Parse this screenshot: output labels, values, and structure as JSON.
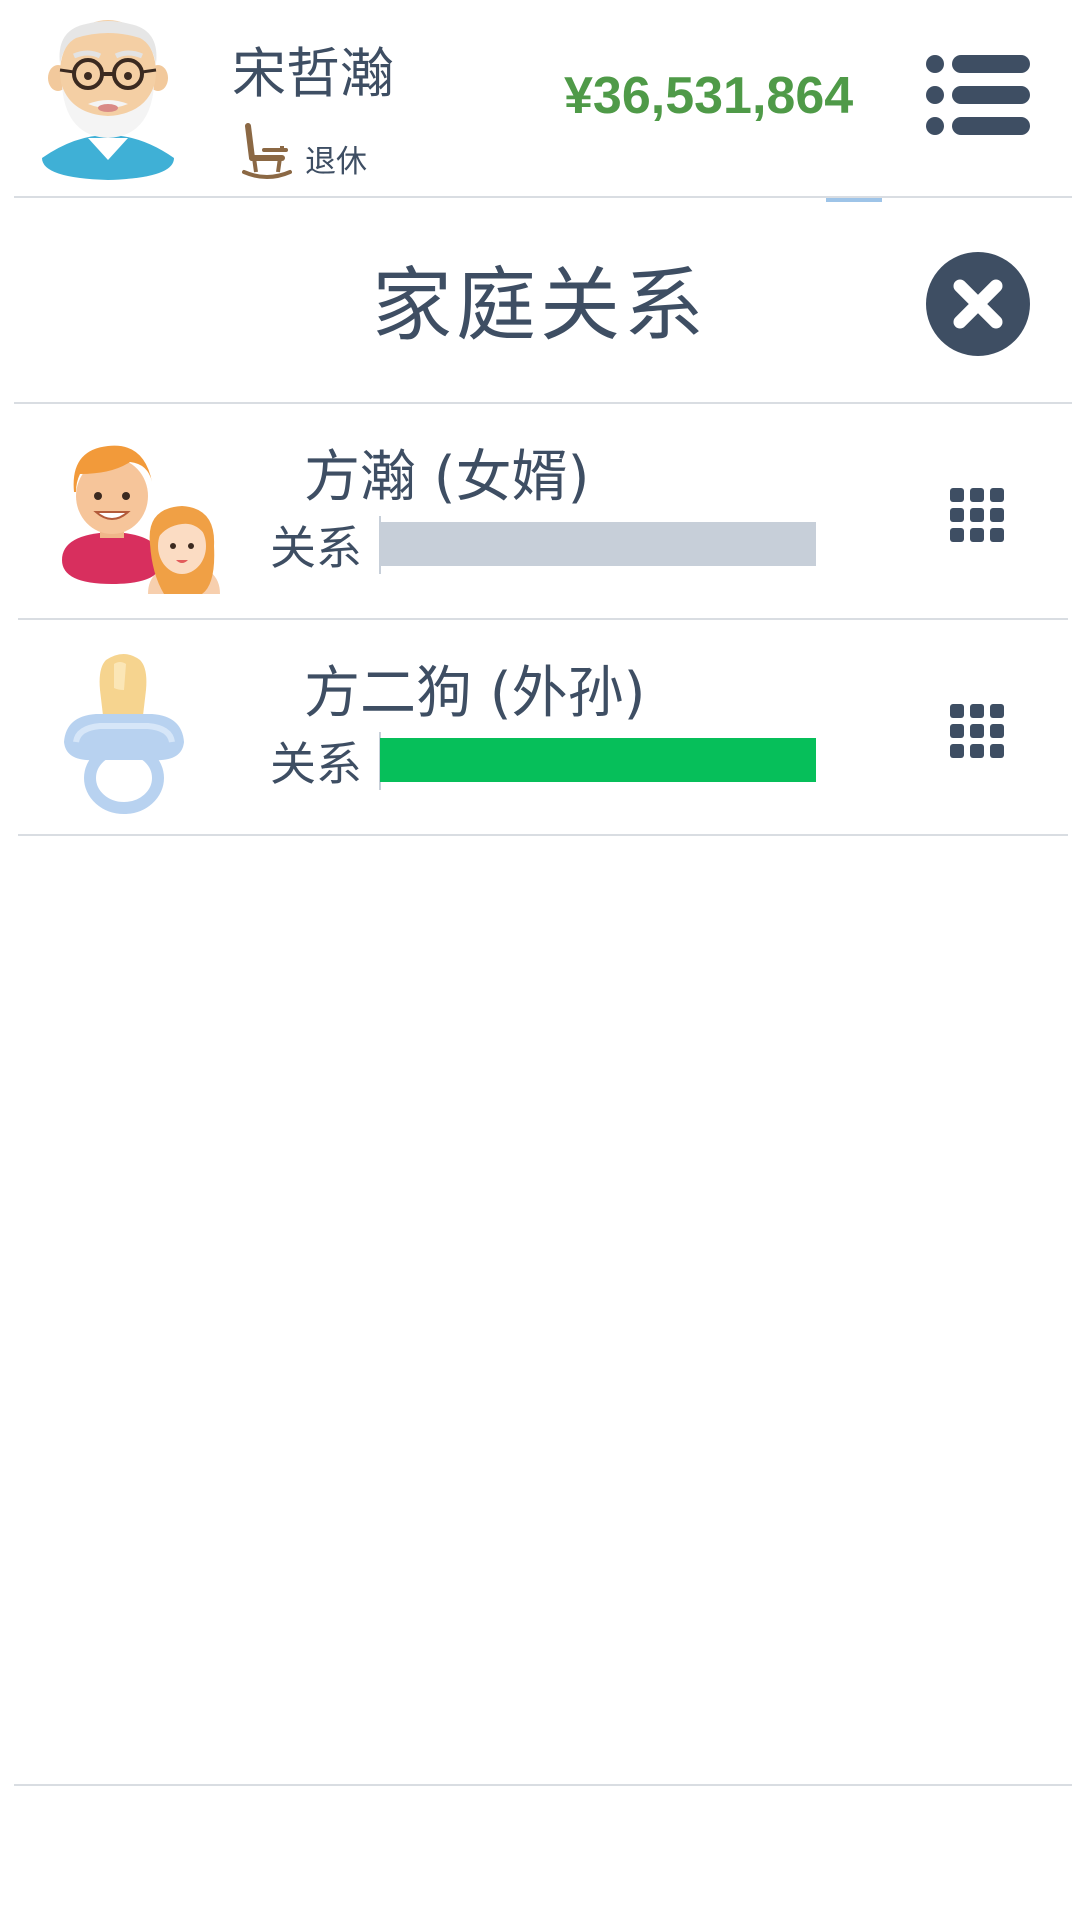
{
  "header": {
    "player_name": "宋哲瀚",
    "status_text": "退休",
    "money": "¥36,531,864",
    "avatar_icon": "old-man-avatar-icon",
    "status_icon": "rocking-chair-icon",
    "menu_icon": "list-menu-icon"
  },
  "panel": {
    "title": "家庭关系",
    "close_icon": "close-icon"
  },
  "relations": [
    {
      "name": "方瀚 (女婿)",
      "relation_label": "关系",
      "relation_level": 0.0,
      "bar_color": "#06bf5a",
      "avatar_icon": "couple-avatar-icon",
      "menu_icon": "grid-menu-icon"
    },
    {
      "name": "方二狗 (外孙)",
      "relation_label": "关系",
      "relation_level": 1.0,
      "bar_color": "#06bf5a",
      "avatar_icon": "pacifier-avatar-icon",
      "menu_icon": "grid-menu-icon"
    }
  ],
  "colors": {
    "text": "#3e4e63",
    "money": "#4f9a48",
    "bar_track": "#c7cfd9",
    "bar_fill": "#06bf5a",
    "divider": "#d9dde2"
  }
}
